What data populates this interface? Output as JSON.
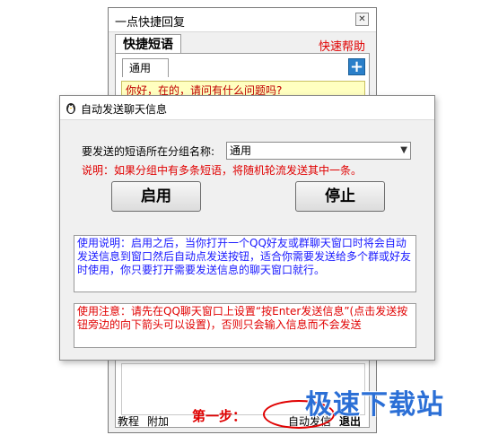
{
  "back_window": {
    "title": "一点快捷回复",
    "close_icon": "✕",
    "tab_label": "快捷短语",
    "help_link": "快速帮助",
    "group_tab": "通用",
    "add_icon": "+",
    "phrase_item": "你好，在的，请问有什么问题吗?",
    "bottom": {
      "tutorial": "教程",
      "attach": "附加",
      "step": "第一步：",
      "auto_send": "自动发信",
      "exit": "退出"
    }
  },
  "dialog": {
    "title": "自动发送聊天信息",
    "group_label": "要发送的短语所在分组名称:",
    "group_value": "通用",
    "note": "说明：如果分组中有多条短语，将随机轮流发送其中一条。",
    "start_button": "启用",
    "stop_button": "停止",
    "usage_text": "使用说明：启用之后，当你打开一个QQ好友或群聊天窗口时将会自动发送信息到窗口然后自动点发送按钮，适合你需要发送给多个群或好友时使用，你只要打开需要发送信息的聊天窗口就行。",
    "warning_text": "使用注意：请先在QQ聊天窗口上设置“按Enter发送信息”(点击发送按钮旁边的向下箭头可以设置)，否则只会输入信息而不会发送"
  },
  "watermark": "极速下载站",
  "colors": {
    "red": "#e00000",
    "blue_text": "#1a1aff",
    "highlight": "#ffffc0",
    "accent": "#2a7fc9"
  }
}
